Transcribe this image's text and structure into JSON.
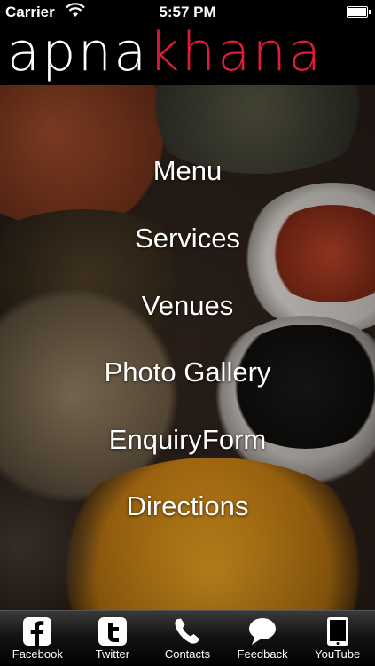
{
  "status_bar": {
    "carrier": "Carrier",
    "time": "5:57 PM"
  },
  "header": {
    "logo_part1": "apna",
    "logo_part2": "khana",
    "accent_color": "#e01b38"
  },
  "menu": {
    "items": [
      {
        "label": "Menu"
      },
      {
        "label": "Services"
      },
      {
        "label": "Venues"
      },
      {
        "label": "Photo Gallery"
      },
      {
        "label": "EnquiryForm"
      },
      {
        "label": "Directions"
      }
    ]
  },
  "tabbar": {
    "tabs": [
      {
        "label": "Facebook",
        "icon": "facebook-icon"
      },
      {
        "label": "Twitter",
        "icon": "twitter-icon"
      },
      {
        "label": "Contacts",
        "icon": "phone-icon"
      },
      {
        "label": "Feedback",
        "icon": "speech-bubble-icon"
      },
      {
        "label": "YouTube",
        "icon": "tablet-icon"
      }
    ]
  }
}
